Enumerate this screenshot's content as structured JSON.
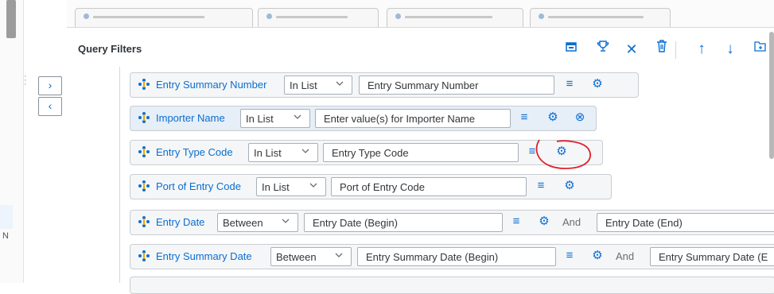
{
  "panel": {
    "title": "Query Filters"
  },
  "left": {
    "partial_char": "N"
  },
  "toolbar": {
    "icons": [
      "variant-icon",
      "trophy-icon",
      "close-icon",
      "delete-icon",
      "arrow-up-icon",
      "arrow-down-icon",
      "add-folder-icon"
    ]
  },
  "nav": {
    "forward": "›",
    "back": "‹"
  },
  "filters": [
    {
      "name": "Entry Summary Number",
      "operator": "In List",
      "value": "Entry Summary Number",
      "highlighted": false,
      "has_clear": false
    },
    {
      "name": "Importer Name",
      "operator": "In List",
      "value": "Enter value(s) for Importer Name",
      "highlighted": true,
      "has_clear": true
    },
    {
      "name": "Entry Type Code",
      "operator": "In List",
      "value": "Entry Type Code",
      "highlighted": false,
      "has_clear": false,
      "annotated": true
    },
    {
      "name": "Port of Entry Code",
      "operator": "In List",
      "value": "Port of Entry Code",
      "highlighted": false,
      "has_clear": false
    },
    {
      "name": "Entry Date",
      "operator": "Between",
      "value": "Entry Date (Begin)",
      "and_label": "And",
      "value2": "Entry Date (End)",
      "highlighted": false
    },
    {
      "name": "Entry Summary Date",
      "operator": "Between",
      "value": "Entry Summary Date (Begin)",
      "and_label": "And",
      "value2": "Entry Summary Date (E",
      "highlighted": false
    }
  ],
  "colors": {
    "accent": "#0a6ed1",
    "annotation": "#e0202a",
    "highlight_row": "#e6eef7"
  }
}
